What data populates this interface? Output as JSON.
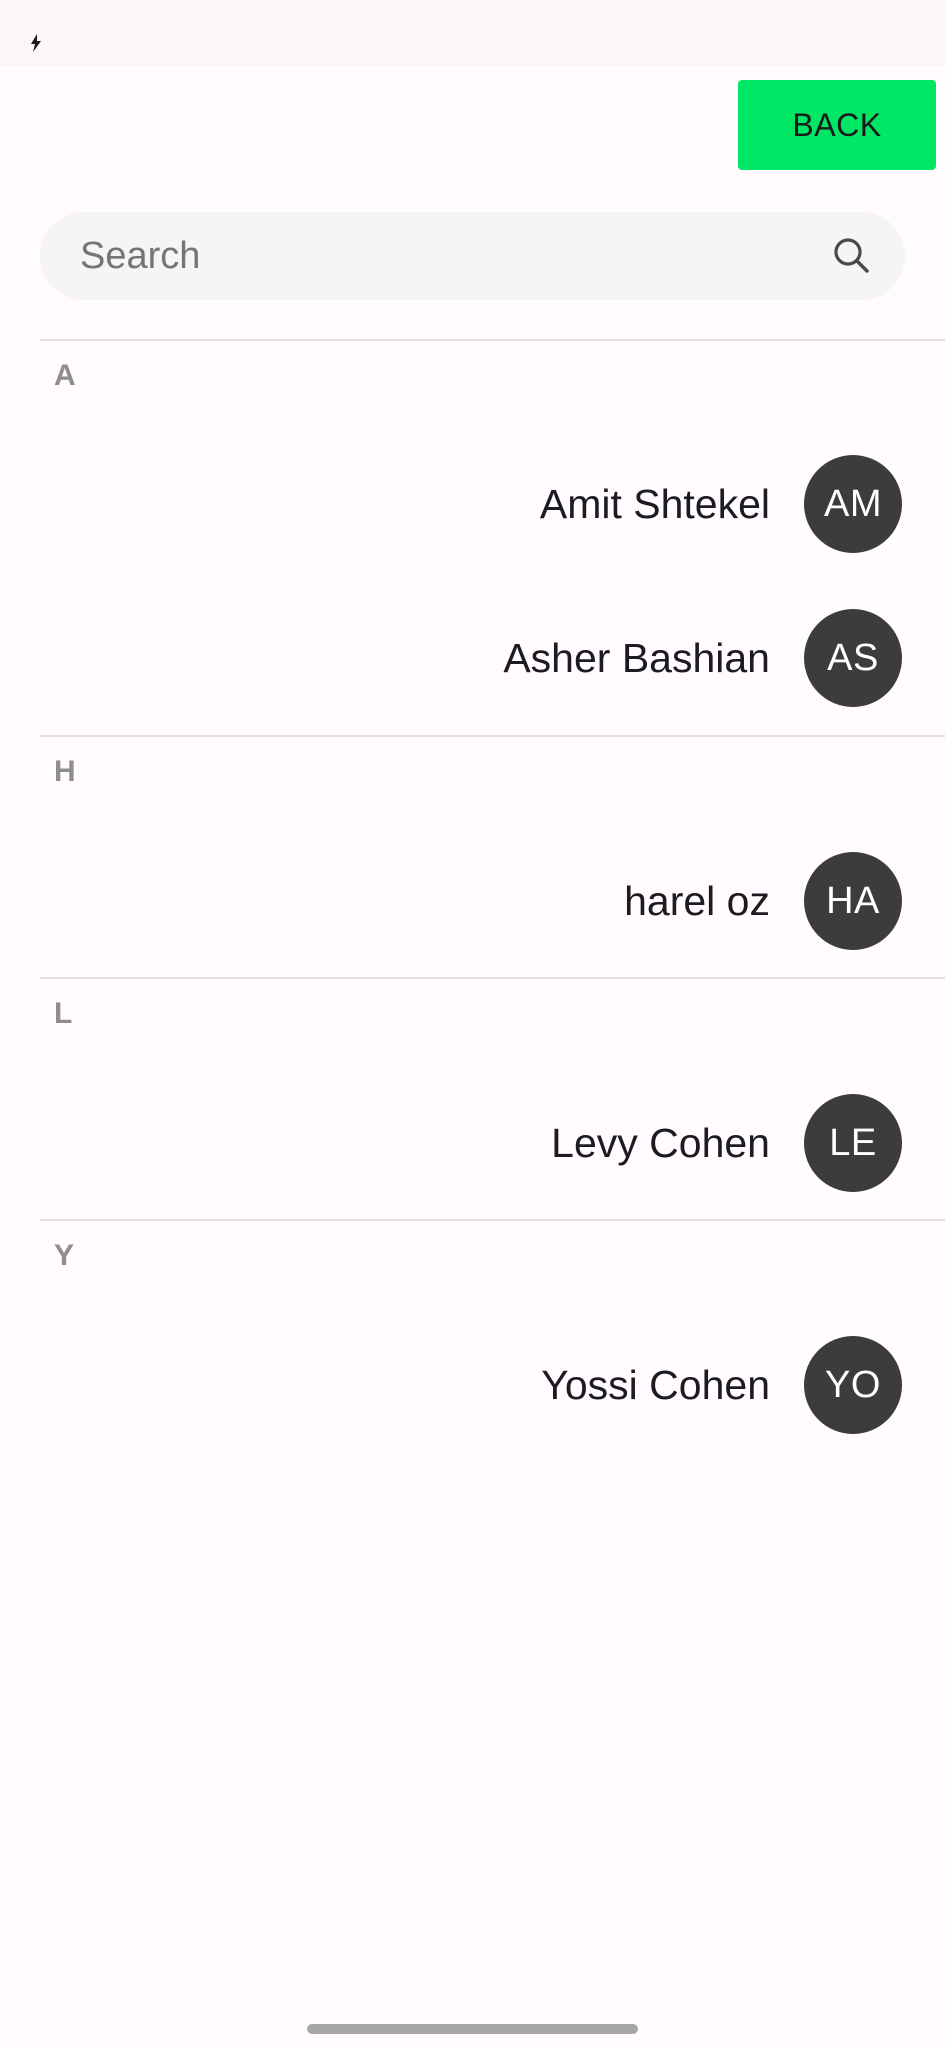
{
  "header": {
    "back_label": "BACK"
  },
  "search": {
    "placeholder": "Search",
    "value": ""
  },
  "sections": [
    {
      "letter": "A",
      "contacts": [
        {
          "name": "Amit Shtekel",
          "initials": "AM"
        },
        {
          "name": "Asher Bashian",
          "initials": "AS"
        }
      ]
    },
    {
      "letter": "H",
      "contacts": [
        {
          "name": "harel oz",
          "initials": "HA"
        }
      ]
    },
    {
      "letter": "L",
      "contacts": [
        {
          "name": "Levy Cohen",
          "initials": "LE"
        }
      ]
    },
    {
      "letter": "Y",
      "contacts": [
        {
          "name": "Yossi Cohen",
          "initials": "YO"
        }
      ]
    }
  ],
  "theme": {
    "accent": "#00e765",
    "avatar_bg": "#3c3c3c",
    "section_letter": "#8e8e8e",
    "divider": "#e0e0e0",
    "search_bg": "#f5f5f5"
  },
  "icons": {
    "status": "charging-bolt-icon",
    "search": "search-icon"
  }
}
